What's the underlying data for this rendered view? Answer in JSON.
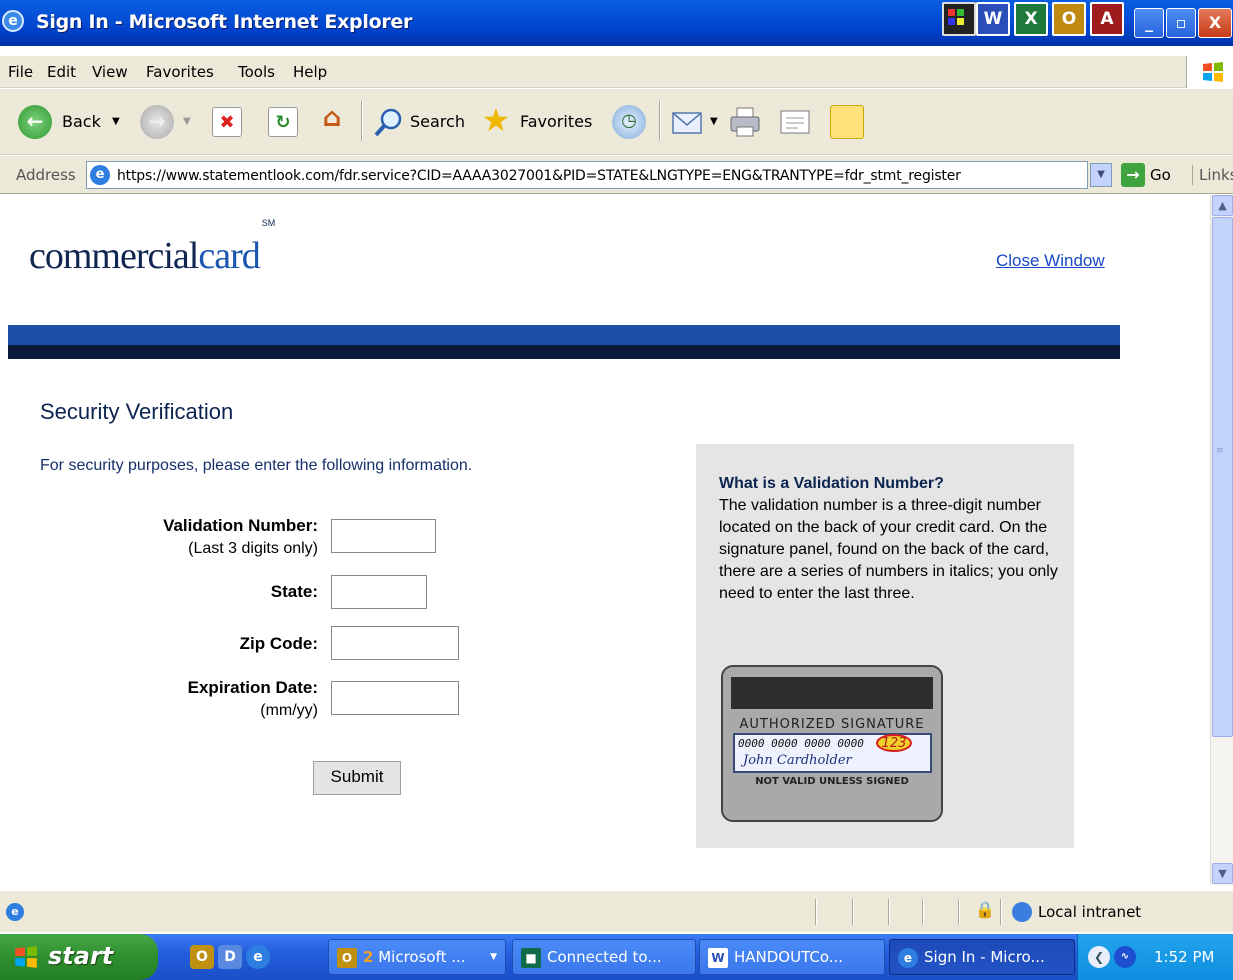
{
  "window": {
    "title": "Sign In - Microsoft Internet Explorer",
    "office_icons": [
      "W",
      "X",
      "O",
      "A"
    ],
    "controls": [
      "_",
      "▫",
      "X"
    ]
  },
  "menu": [
    "File",
    "Edit",
    "View",
    "Favorites",
    "Tools",
    "Help"
  ],
  "toolbar": {
    "back": "Back",
    "search": "Search",
    "favorites": "Favorites"
  },
  "address": {
    "label": "Address",
    "url": "https://www.statementlook.com/fdr.service?CID=AAAA3027001&PID=STATE&LNGTYPE=ENG&TRANTYPE=fdr_stmt_register",
    "go": "Go",
    "links": "Links"
  },
  "page": {
    "logo_main": "commercial",
    "logo_accent": "card",
    "logo_mark": "SM",
    "close_window": "Close Window",
    "heading": "Security Verification",
    "intro": "For security purposes, please enter the following information.",
    "fields": {
      "validation_label": "Validation Number:",
      "validation_hint": "(Last 3 digits only)",
      "state_label": "State:",
      "zip_label": "Zip Code:",
      "expiration_label": "Expiration Date:",
      "expiration_hint": "(mm/yy)"
    },
    "submit": "Submit",
    "help": {
      "title": "What is a Validation Number?",
      "body": "The validation number is a three-digit number located on the back of your credit card. On the signature panel, found on the back of the card, there are a series of numbers in italics; you only need to enter the last three."
    },
    "card_image": {
      "authorized": "AUTHORIZED SIGNATURE",
      "digits": "0000 0000 0000 0000",
      "cvv": "123",
      "holder": "John Cardholder",
      "not_valid": "NOT VALID UNLESS SIGNED"
    }
  },
  "status": {
    "zone": "Local intranet"
  },
  "taskbar": {
    "start": "start",
    "buttons": [
      {
        "count": "2",
        "label": "Microsoft ..."
      },
      {
        "label": "Connected to..."
      },
      {
        "label": "HANDOUTCo..."
      },
      {
        "label": "Sign In - Micro..."
      }
    ],
    "clock": "1:52 PM"
  },
  "colors": {
    "title_bar": "#0550d8",
    "banner_blue": "#1c4fa8",
    "banner_navy": "#0c1a3c",
    "link": "#1748c8",
    "heading": "#0c2450",
    "help_panel": "#e5e5e5",
    "start_green": "#2f8f2f",
    "taskbar_blue": "#245edc"
  }
}
